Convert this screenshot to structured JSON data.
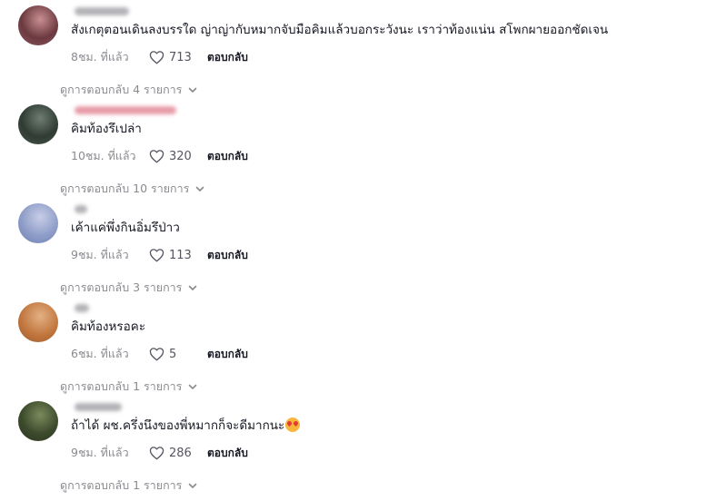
{
  "comments": [
    {
      "text": "สังเกตุตอนเดินลงบรรใด ญ่าญ่ากับหมากจับมือคิมแล้วบอกระวังนะ เราว่าท้องแน่น สโพกผายออกชัดเจน",
      "time": "8ชม. ที่แล้ว",
      "likes": "713",
      "reply_label": "ตอบกลับ",
      "view_replies": "ดูการตอบกลับ 4 รายการ",
      "avatar_colors": [
        "#6b3a3f",
        "#c98f92",
        "#8c5560"
      ],
      "username_color": "#9a9aa0"
    },
    {
      "text": "คิมท้องรึเปล่า",
      "time": "10ชม. ที่แล้ว",
      "likes": "320",
      "reply_label": "ตอบกลับ",
      "view_replies": "ดูการตอบกลับ 10 รายการ",
      "avatar_colors": [
        "#2f3b33",
        "#6e7d72",
        "#48564c"
      ],
      "username_color": "#e07a8a"
    },
    {
      "text": "เค้าแค่พึ่งกินอิ่มรึป่าว",
      "time": "9ชม. ที่แล้ว",
      "likes": "113",
      "reply_label": "ตอบกลับ",
      "view_replies": "ดูการตอบกลับ 3 รายการ",
      "avatar_colors": [
        "#8e9dc8",
        "#c7cde6",
        "#6d7fb4"
      ],
      "username_color": "#9a9aa0"
    },
    {
      "text": "คิมท้องหรอคะ",
      "time": "6ชม. ที่แล้ว",
      "likes": "5",
      "reply_label": "ตอบกลับ",
      "view_replies": "ดูการตอบกลับ 1 รายการ",
      "avatar_colors": [
        "#c2773f",
        "#e2b184",
        "#9d5a2c"
      ],
      "username_color": "#9a9aa0"
    },
    {
      "text": "ถ้าได้ ผช.ครึ่งนึงของพี่หมากก็จะดีมากนะ",
      "emoji": "smiling-face-with-heart-eyes",
      "time": "9ชม. ที่แล้ว",
      "likes": "286",
      "reply_label": "ตอบกลับ",
      "view_replies": "ดูการตอบกลับ 1 รายการ",
      "avatar_colors": [
        "#3c4a2c",
        "#7a8a5c",
        "#2c3520"
      ],
      "username_color": "#9a9aa0"
    }
  ],
  "icons": {
    "like": "heart-outline-icon",
    "expand": "chevron-down-icon"
  }
}
